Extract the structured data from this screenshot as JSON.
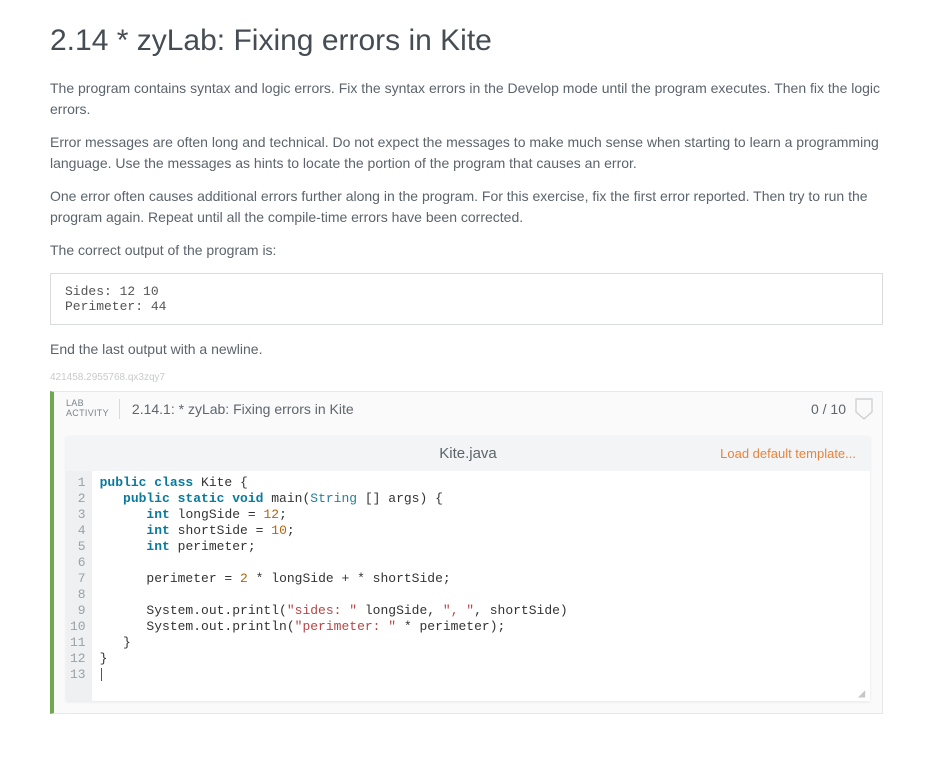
{
  "heading": "2.14 * zyLab: Fixing errors in Kite",
  "paragraphs": {
    "p1": "The program contains syntax and logic errors. Fix the syntax errors in the Develop mode until the program executes. Then fix the logic errors.",
    "p2": "Error messages are often long and technical. Do not expect the messages to make much sense when starting to learn a programming language. Use the messages as hints to locate the portion of the program that causes an error.",
    "p3": "One error often causes additional errors further along in the program. For this exercise, fix the first error reported. Then try to run the program again. Repeat until all the compile-time errors have been corrected.",
    "p4": "The correct output of the program is:",
    "p5": "End the last output with a newline."
  },
  "expected_output": "Sides: 12 10\nPerimeter: 44",
  "watermark": "421458.2955768.qx3zqy7",
  "activity": {
    "label_line1": "LAB",
    "label_line2": "ACTIVITY",
    "title": "2.14.1: * zyLab: Fixing errors in Kite",
    "score": "0 / 10",
    "filename": "Kite.java",
    "load_template": "Load default template...",
    "line_numbers": " 1\n 2\n 3\n 4\n 5\n 6\n 7\n 8\n 9\n10\n11\n12\n13"
  },
  "code_tokens": [
    [
      {
        "t": "public ",
        "c": "kw"
      },
      {
        "t": "class ",
        "c": "kw"
      },
      {
        "t": "Kite {",
        "c": "cls"
      }
    ],
    [
      {
        "t": "   ",
        "c": ""
      },
      {
        "t": "public ",
        "c": "kw"
      },
      {
        "t": "static ",
        "c": "kw"
      },
      {
        "t": "void ",
        "c": "kw"
      },
      {
        "t": "main(",
        "c": "id"
      },
      {
        "t": "String",
        "c": "type"
      },
      {
        "t": " [] args) {",
        "c": "id"
      }
    ],
    [
      {
        "t": "      ",
        "c": ""
      },
      {
        "t": "int ",
        "c": "kw"
      },
      {
        "t": "longSide = ",
        "c": "id"
      },
      {
        "t": "12",
        "c": "num"
      },
      {
        "t": ";",
        "c": "id"
      }
    ],
    [
      {
        "t": "      ",
        "c": ""
      },
      {
        "t": "int ",
        "c": "kw"
      },
      {
        "t": "shortSide = ",
        "c": "id"
      },
      {
        "t": "10",
        "c": "num"
      },
      {
        "t": ";",
        "c": "id"
      }
    ],
    [
      {
        "t": "      ",
        "c": ""
      },
      {
        "t": "int ",
        "c": "kw"
      },
      {
        "t": "perimeter;",
        "c": "id"
      }
    ],
    [
      {
        "t": "",
        "c": ""
      }
    ],
    [
      {
        "t": "      perimeter = ",
        "c": "id"
      },
      {
        "t": "2",
        "c": "num"
      },
      {
        "t": " * longSide + * shortSide;",
        "c": "id"
      }
    ],
    [
      {
        "t": "",
        "c": ""
      }
    ],
    [
      {
        "t": "      System.out.printl(",
        "c": "id"
      },
      {
        "t": "\"sides: \"",
        "c": "str"
      },
      {
        "t": " longSide, ",
        "c": "id"
      },
      {
        "t": "\", \"",
        "c": "str"
      },
      {
        "t": ", shortSide)",
        "c": "id"
      }
    ],
    [
      {
        "t": "      System.out.println(",
        "c": "id"
      },
      {
        "t": "\"perimeter: \"",
        "c": "str"
      },
      {
        "t": " * perimeter);",
        "c": "id"
      }
    ],
    [
      {
        "t": "   }",
        "c": "id"
      }
    ],
    [
      {
        "t": "}",
        "c": "id"
      }
    ],
    [
      {
        "t": "",
        "c": ""
      }
    ]
  ]
}
